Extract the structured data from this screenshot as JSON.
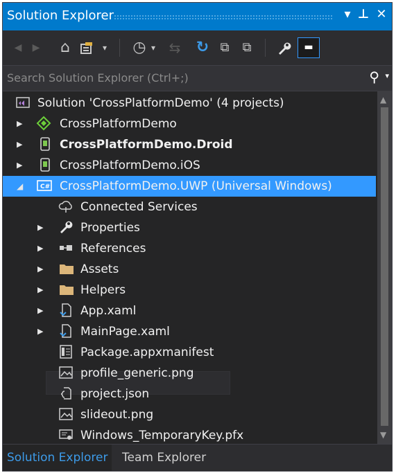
{
  "panel": {
    "title": "Solution Explorer",
    "title_buttons": {
      "dropdown": "▾",
      "pin": "⊥",
      "close": "✕"
    }
  },
  "toolbar": {
    "back": "◀",
    "forward": "▶",
    "home": "⌂",
    "sync": "⇄",
    "dd1": "▾",
    "history": "◷",
    "dd2": "▾",
    "pending": "⇆",
    "refresh": "↻",
    "collapse": "⧉",
    "show_all": "⧉",
    "properties": "🔧",
    "preview": "▬"
  },
  "search": {
    "placeholder": "Search Solution Explorer (Ctrl+;)",
    "icon": "⚲",
    "dropdown": "▾"
  },
  "tree": {
    "solution": {
      "label": "Solution 'CrossPlatformDemo' (4 projects)",
      "icon": "solution-icon"
    },
    "projects": [
      {
        "label": "CrossPlatformDemo",
        "icon": "shared-project-icon",
        "expander": "▶"
      },
      {
        "label": "CrossPlatformDemo.Droid",
        "icon": "android-project-icon",
        "expander": "▶"
      },
      {
        "label": "CrossPlatformDemo.iOS",
        "icon": "ios-project-icon",
        "expander": "▶"
      },
      {
        "label": "CrossPlatformDemo.UWP (Universal Windows)",
        "icon": "csharp-project-icon",
        "expander": "◢"
      }
    ],
    "uwp_children": [
      {
        "label": "Connected Services",
        "icon": "connected-services-icon",
        "expander": ""
      },
      {
        "label": "Properties",
        "icon": "wrench-icon",
        "expander": "▶"
      },
      {
        "label": "References",
        "icon": "references-icon",
        "expander": "▶"
      },
      {
        "label": "Assets",
        "icon": "folder-icon",
        "expander": "▶"
      },
      {
        "label": "Helpers",
        "icon": "folder-icon",
        "expander": "▶"
      },
      {
        "label": "App.xaml",
        "icon": "xaml-file-icon",
        "expander": "▶"
      },
      {
        "label": "MainPage.xaml",
        "icon": "xaml-file-icon",
        "expander": "▶"
      },
      {
        "label": "Package.appxmanifest",
        "icon": "manifest-file-icon",
        "expander": ""
      },
      {
        "label": "profile_generic.png",
        "icon": "image-file-icon",
        "expander": ""
      },
      {
        "label": "project.json",
        "icon": "json-file-icon",
        "expander": ""
      },
      {
        "label": "slideout.png",
        "icon": "image-file-icon",
        "expander": ""
      },
      {
        "label": "Windows_TemporaryKey.pfx",
        "icon": "certificate-file-icon",
        "expander": ""
      }
    ]
  },
  "scrollbar": {
    "up": "▲",
    "down": "▼"
  },
  "bottom_tabs": [
    {
      "label": "Solution Explorer",
      "active": true
    },
    {
      "label": "Team Explorer",
      "active": false
    }
  ],
  "colors": {
    "accent": "#007acc",
    "selection": "#3399ff",
    "background": "#252526",
    "text": "#f1f1f1"
  }
}
